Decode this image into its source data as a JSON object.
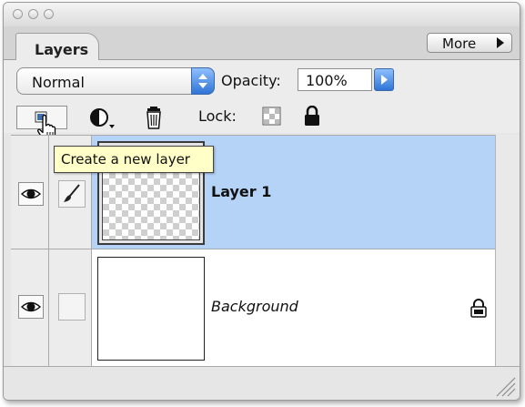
{
  "panel": {
    "tab_label": "Layers",
    "more_label": "More"
  },
  "options": {
    "blend_mode": "Normal",
    "opacity_label": "Opacity:",
    "opacity_value": "100%",
    "lock_label": "Lock:"
  },
  "tooltip": {
    "text": "Create a new layer"
  },
  "layers": [
    {
      "name": "Layer 1",
      "selected": true,
      "visible": true,
      "transparent_thumb": true
    },
    {
      "name": "Background",
      "selected": false,
      "visible": true,
      "locked": true,
      "italic": true
    }
  ],
  "colors": {
    "selection": "#b5d3f7",
    "tooltip_bg": "#ffffc7",
    "aqua_blue": "#2f74d6"
  }
}
